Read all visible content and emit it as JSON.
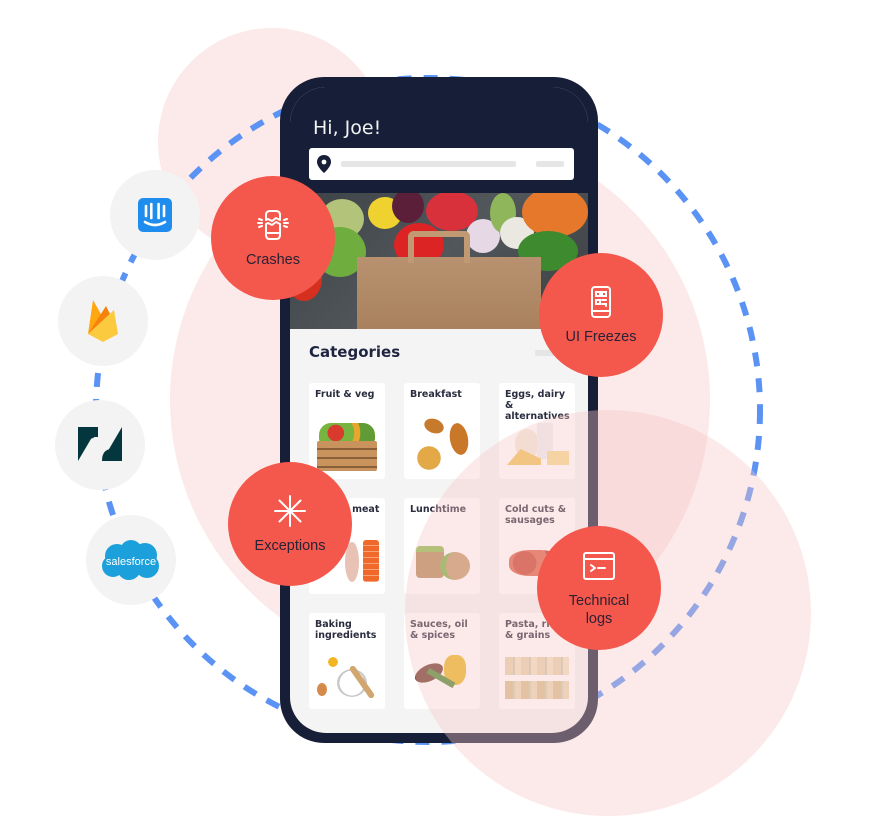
{
  "app": {
    "greeting": "Hi, Joe!",
    "search": {
      "placeholder": ""
    },
    "categories_title": "Categories",
    "categories": [
      {
        "label": "Fruit & veg"
      },
      {
        "label": "Breakfast"
      },
      {
        "label": "Eggs, dairy & alternatives"
      },
      {
        "label": "Fish & meat"
      },
      {
        "label": "Lunchtime"
      },
      {
        "label": "Cold cuts & sausages"
      },
      {
        "label": "Baking ingredients"
      },
      {
        "label": "Sauces, oil & spices"
      },
      {
        "label": "Pasta, rice & grains"
      }
    ]
  },
  "features": [
    {
      "label": "Crashes",
      "icon": "cracked-phone-icon"
    },
    {
      "label": "UI Freezes",
      "icon": "phone-qr-icon"
    },
    {
      "label": "Exceptions",
      "icon": "asterisk-icon"
    },
    {
      "label": "Technical logs",
      "icon": "terminal-icon"
    }
  ],
  "integrations": [
    {
      "name": "Intercom",
      "icon": "intercom-icon"
    },
    {
      "name": "Firebase",
      "icon": "firebase-icon"
    },
    {
      "name": "Zendesk",
      "icon": "zendesk-icon"
    },
    {
      "name": "Salesforce",
      "icon": "salesforce-icon",
      "logo_text": "salesforce"
    }
  ],
  "colors": {
    "accent": "#f4574b",
    "ring": "#5b93f5",
    "phone": "#171f38",
    "bubble_text": "#2a2236"
  }
}
